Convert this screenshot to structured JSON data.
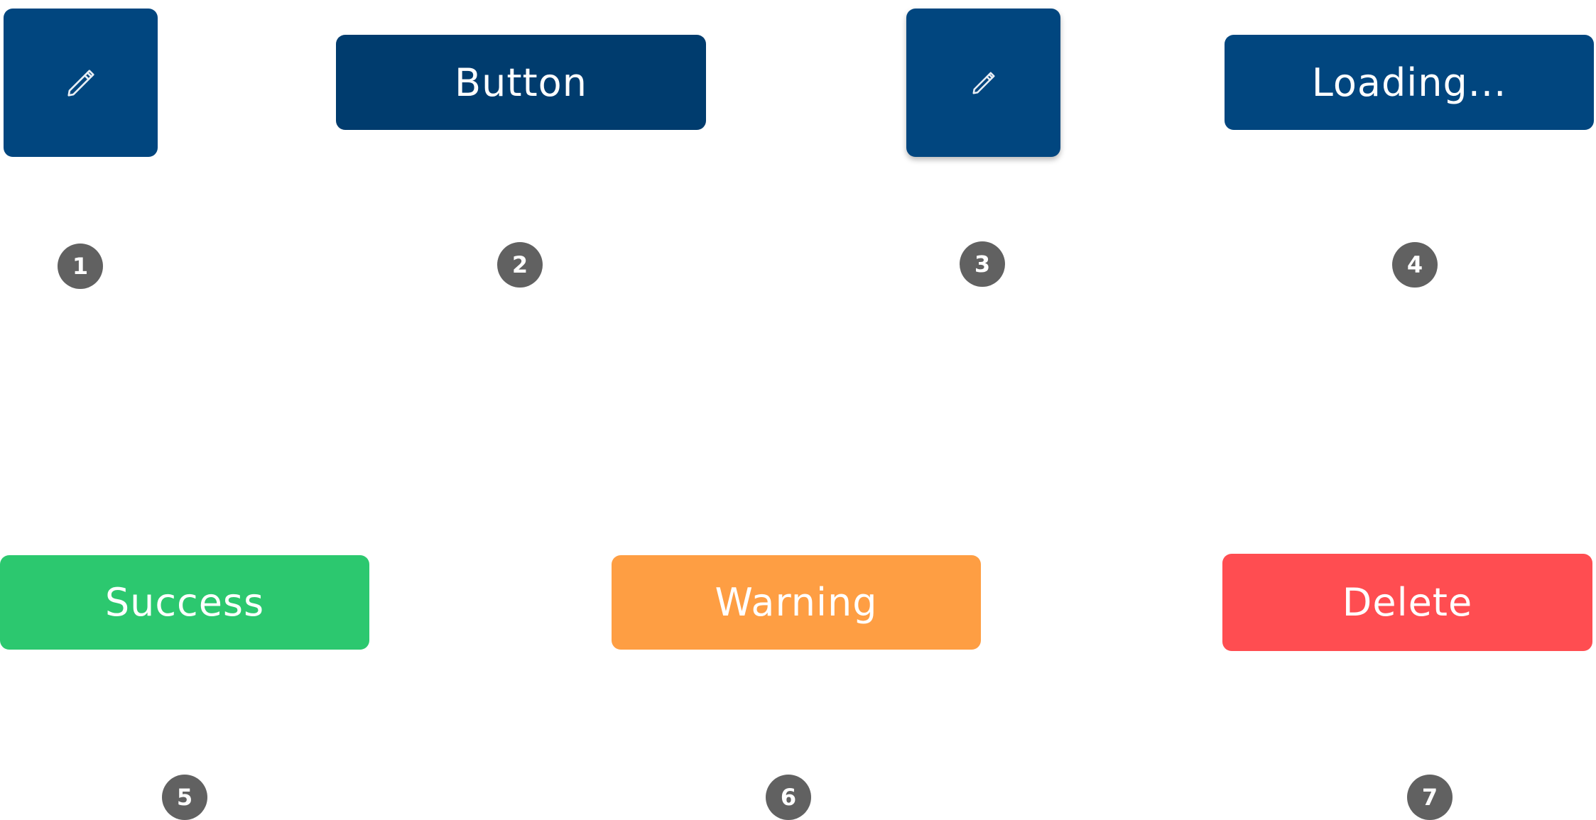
{
  "buttons": {
    "icon_primary": {
      "icon": "pencil-icon"
    },
    "button": {
      "label": "Button"
    },
    "icon_raised": {
      "icon": "pencil-icon"
    },
    "loading": {
      "label": "Loading..."
    },
    "success": {
      "label": "Success",
      "color": "#2cc86f"
    },
    "warning": {
      "label": "Warning",
      "color": "#fe9e43"
    },
    "delete": {
      "label": "Delete",
      "color": "#ff4d51"
    }
  },
  "colors": {
    "primary": "#01467f",
    "primary_pressed": "#003c6e",
    "badge": "#616161"
  },
  "badges": [
    "1",
    "2",
    "3",
    "4",
    "5",
    "6",
    "7"
  ]
}
